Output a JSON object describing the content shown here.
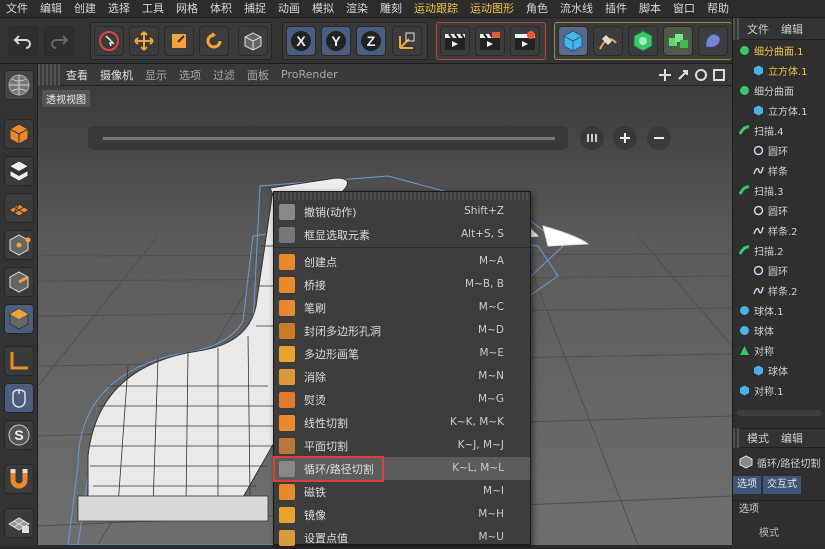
{
  "menubar": {
    "items": [
      {
        "label": "文件",
        "accent": false
      },
      {
        "label": "编辑",
        "accent": false
      },
      {
        "label": "创建",
        "accent": false
      },
      {
        "label": "选择",
        "accent": false
      },
      {
        "label": "工具",
        "accent": false
      },
      {
        "label": "网格",
        "accent": false
      },
      {
        "label": "体积",
        "accent": false
      },
      {
        "label": "捕捉",
        "accent": false
      },
      {
        "label": "动画",
        "accent": false
      },
      {
        "label": "模拟",
        "accent": false
      },
      {
        "label": "渲染",
        "accent": false
      },
      {
        "label": "雕刻",
        "accent": false
      },
      {
        "label": "运动跟踪",
        "accent": true
      },
      {
        "label": "运动图形",
        "accent": true
      },
      {
        "label": "角色",
        "accent": false
      },
      {
        "label": "流水线",
        "accent": false
      },
      {
        "label": "插件",
        "accent": false
      },
      {
        "label": "脚本",
        "accent": false
      },
      {
        "label": "窗口",
        "accent": false
      },
      {
        "label": "帮助",
        "accent": false
      }
    ]
  },
  "viewport_header": {
    "menus": [
      "查看",
      "摄像机",
      "显示",
      "选项",
      "过滤",
      "面板",
      "ProRender"
    ]
  },
  "viewport": {
    "label": "透视视图"
  },
  "object_manager": {
    "tabs": [
      "文件",
      "编辑"
    ],
    "items": [
      {
        "label": "细分曲面.1",
        "indent": 0,
        "icon": "subdivision-icon",
        "highlight": true
      },
      {
        "label": "立方体.1",
        "indent": 1,
        "icon": "cube-object-icon",
        "highlight": true
      },
      {
        "label": "细分曲面",
        "indent": 0,
        "icon": "subdivision-icon",
        "highlight": false
      },
      {
        "label": "立方体.1",
        "indent": 1,
        "icon": "cube-object-icon",
        "highlight": false
      },
      {
        "label": "扫描.4",
        "indent": 0,
        "icon": "sweep-icon",
        "highlight": false
      },
      {
        "label": "圆环",
        "indent": 1,
        "icon": "circle-spline-icon",
        "highlight": false
      },
      {
        "label": "样条",
        "indent": 1,
        "icon": "spline-icon",
        "highlight": false
      },
      {
        "label": "扫描.3",
        "indent": 0,
        "icon": "sweep-icon",
        "highlight": false
      },
      {
        "label": "圆环",
        "indent": 1,
        "icon": "circle-spline-icon",
        "highlight": false
      },
      {
        "label": "样条.2",
        "indent": 1,
        "icon": "spline-icon",
        "highlight": false
      },
      {
        "label": "扫描.2",
        "indent": 0,
        "icon": "sweep-icon",
        "highlight": false
      },
      {
        "label": "圆环",
        "indent": 1,
        "icon": "circle-spline-icon",
        "highlight": false
      },
      {
        "label": "样条.2",
        "indent": 1,
        "icon": "spline-icon",
        "highlight": false
      },
      {
        "label": "球体.1",
        "indent": 0,
        "icon": "sphere-icon",
        "highlight": false
      },
      {
        "label": "球体",
        "indent": 0,
        "icon": "sphere-icon",
        "highlight": false
      },
      {
        "label": "对称",
        "indent": 0,
        "icon": "symmetry-icon",
        "highlight": false
      },
      {
        "label": "球体",
        "indent": 1,
        "icon": "cube-object-icon",
        "highlight": false
      },
      {
        "label": "对称.1",
        "indent": 0,
        "icon": "cube-object-icon",
        "highlight": false
      }
    ]
  },
  "attribute_manager": {
    "tabs": [
      "模式",
      "编辑"
    ],
    "title": "循环/路径切割",
    "subtabs": [
      "选项",
      "交互式"
    ],
    "section": "选项",
    "field_label": "模式"
  },
  "context_menu": {
    "groups": [
      [
        {
          "label": "撤销(动作)",
          "shortcut": "Shift+Z",
          "icon": "undo-icon"
        },
        {
          "label": "框显选取元素",
          "shortcut": "Alt+S, S",
          "icon": "frame-selection-icon"
        }
      ],
      [
        {
          "label": "创建点",
          "shortcut": "M~A",
          "icon": "create-point-icon"
        },
        {
          "label": "桥接",
          "shortcut": "M~B, B",
          "icon": "bridge-icon"
        },
        {
          "label": "笔刷",
          "shortcut": "M~C",
          "icon": "brush-icon"
        },
        {
          "label": "封闭多边形孔洞",
          "shortcut": "M~D",
          "icon": "close-hole-icon"
        },
        {
          "label": "多边形画笔",
          "shortcut": "M~E",
          "icon": "polygon-pen-icon"
        },
        {
          "label": "消除",
          "shortcut": "M~N",
          "icon": "dissolve-icon"
        },
        {
          "label": "熨烫",
          "shortcut": "M~G",
          "icon": "iron-icon"
        },
        {
          "label": "线性切割",
          "shortcut": "K~K, M~K",
          "icon": "line-cut-icon"
        },
        {
          "label": "平面切割",
          "shortcut": "K~J, M~J",
          "icon": "plane-cut-icon"
        },
        {
          "label": "循环/路径切割",
          "shortcut": "K~L, M~L",
          "icon": "loop-cut-icon",
          "active": true
        },
        {
          "label": "磁铁",
          "shortcut": "M~I",
          "icon": "magnet-icon"
        },
        {
          "label": "镜像",
          "shortcut": "M~H",
          "icon": "mirror-icon"
        },
        {
          "label": "设置点值",
          "shortcut": "M~U",
          "icon": "set-point-value-icon"
        }
      ]
    ]
  },
  "colors": {
    "accent": "#f2c34b",
    "highlight_border": "#e23b3b",
    "menu_bg": "#3d3d3d",
    "viewport_bg": "#6b6b6b"
  }
}
